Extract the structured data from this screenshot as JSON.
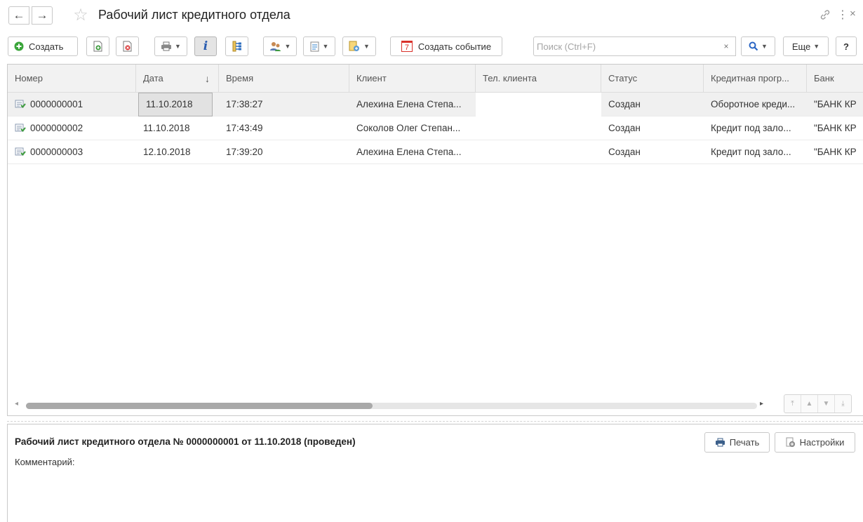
{
  "window": {
    "title": "Рабочий лист кредитного отдела",
    "back_icon": "arrow-left-icon",
    "forward_icon": "arrow-right-icon",
    "favorite_icon": "star-icon",
    "link_icon": "link-icon",
    "more_icon": "kebab-icon",
    "close_icon": "close-icon"
  },
  "toolbar": {
    "create_label": "Создать",
    "create_event_label": "Создать событие",
    "more_label": "Еще",
    "help_label": "?",
    "event_icon_text": "7"
  },
  "search": {
    "placeholder": "Поиск (Ctrl+F)",
    "value": "",
    "clear_label": "×"
  },
  "table": {
    "columns": [
      {
        "label": "Номер"
      },
      {
        "label": "Дата",
        "sort": "↓"
      },
      {
        "label": "Время"
      },
      {
        "label": "Клиент"
      },
      {
        "label": "Тел. клиента"
      },
      {
        "label": "Статус"
      },
      {
        "label": "Кредитная прогр..."
      },
      {
        "label": "Банк"
      }
    ],
    "rows": [
      {
        "number": "0000000001",
        "date": "11.10.2018",
        "time": "17:38:27",
        "client": "Алехина Елена Степа...",
        "phone": "",
        "status": "Создан",
        "program": "Оборотное креди...",
        "bank": "\"БАНК КР"
      },
      {
        "number": "0000000002",
        "date": "11.10.2018",
        "time": "17:43:49",
        "client": "Соколов Олег Степан...",
        "phone": "",
        "status": "Создан",
        "program": "Кредит под зало...",
        "bank": "\"БАНК КР"
      },
      {
        "number": "0000000003",
        "date": "12.10.2018",
        "time": "17:39:20",
        "client": "Алехина Елена Степа...",
        "phone": "",
        "status": "Создан",
        "program": "Кредит под зало...",
        "bank": "\"БАНК КР"
      }
    ],
    "selected_row": 0
  },
  "detail": {
    "title": "Рабочий лист кредитного отдела № 0000000001 от 11.10.2018 (проведен)",
    "comment_label": "Комментарий:",
    "print_label": "Печать",
    "settings_label": "Настройки"
  },
  "colors": {
    "create_green": "#3aa53a",
    "add_green": "#3e9b3e",
    "delete_red": "#d93a3a",
    "info_blue": "#2a5db0",
    "search_blue": "#2b66c4",
    "event_red": "#d9312b",
    "selected_row": "#f0f0f0"
  }
}
